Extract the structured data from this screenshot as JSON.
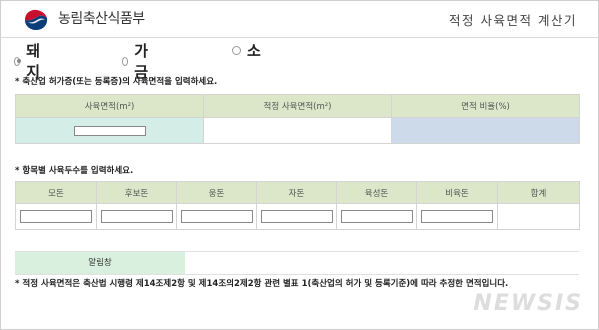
{
  "header": {
    "ministry": "농림축산식품부",
    "calculator_title": "적정 사육면적 계산기"
  },
  "tabs": [
    {
      "label": "돼지",
      "selected": true
    },
    {
      "label": "가금",
      "selected": false
    },
    {
      "label": "소",
      "selected": false
    }
  ],
  "section1": {
    "instruction": "* 축산업 허가증(또는 등록증)의 사육면적을 입력하세요.",
    "headers": [
      "사육면적(m²)",
      "적정 사육면적(m²)",
      "면적 비율(%)"
    ],
    "values": [
      "",
      "",
      ""
    ]
  },
  "section2": {
    "instruction": "* 항목별 사육두수를 입력하세요.",
    "headers": [
      "모돈",
      "후보돈",
      "웅돈",
      "자돈",
      "육성돈",
      "비육돈",
      "합계"
    ],
    "values": [
      "",
      "",
      "",
      "",
      "",
      "",
      ""
    ]
  },
  "alert": {
    "label": "알림창",
    "message": ""
  },
  "note": "* 적정 사육면적은 축산법 시행령 제14조제2항 및 제14조의2제2항 관련 별표 1(축산업의 허가 및 등록기준)에 따라 추정한 면적입니다.",
  "watermark": "NEWSIS",
  "colors": {
    "header_cell_bg": "#dbe7c8",
    "input_cell_green": "#d4ede6",
    "result_cell_blue": "#ccdaea",
    "alert_label_bg": "#d8f0dd"
  }
}
